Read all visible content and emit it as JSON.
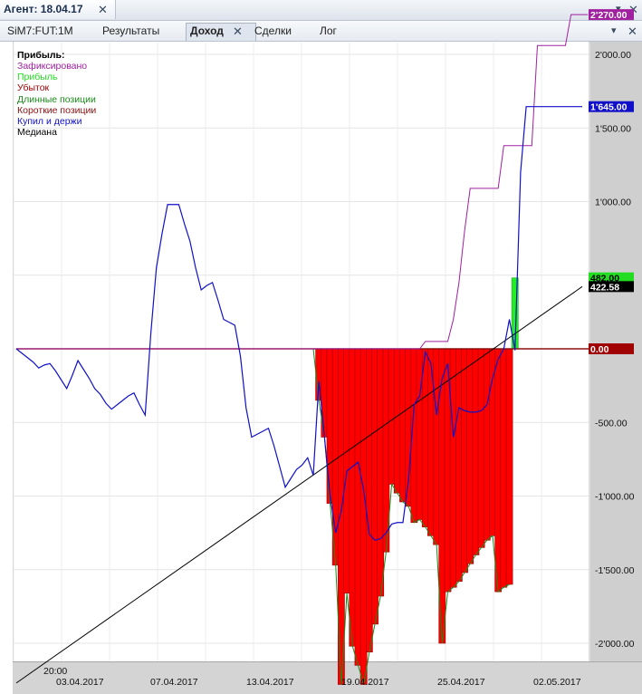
{
  "window": {
    "title": "Агент: 18.04.17",
    "controls": {
      "dropdown": "▾",
      "close": "✕"
    }
  },
  "tabs": [
    {
      "label": "SiM7:FUT:1M",
      "active": false
    },
    {
      "label": "Результаты",
      "active": false
    },
    {
      "label": "Доход",
      "active": true
    },
    {
      "label": "Сделки",
      "active": false
    },
    {
      "label": "Лог",
      "active": false
    }
  ],
  "tabbar_controls": {
    "dropdown": "▾",
    "close": "✕"
  },
  "legend": {
    "title": "Прибыль:",
    "items": [
      {
        "label": "Зафиксировано",
        "color": "#a020a0"
      },
      {
        "label": "Прибыль",
        "color": "#22dd22"
      },
      {
        "label": "Убыток",
        "color": "#a00000"
      },
      {
        "label": "Длинные позиции",
        "color": "#1a8a1a"
      },
      {
        "label": "Короткие позиции",
        "color": "#8b1010"
      },
      {
        "label": "Купил и держи",
        "color": "#1010c8"
      },
      {
        "label": "Медиана",
        "color": "#000000"
      }
    ]
  },
  "chart_data": {
    "type": "line",
    "ylim": [
      -2270,
      2270
    ],
    "y_ticks": [
      2000,
      1500,
      1000,
      500,
      0,
      -500,
      -1000,
      -1500,
      -2000
    ],
    "y_tick_labels": [
      "2'000.00",
      "1'500.00",
      "1'000.00",
      "500.00",
      "0.00",
      "-500.00",
      "-1'000.00",
      "-1'500.00",
      "-2'000.00"
    ],
    "x_top_label": "20:00",
    "x_tick_labels": [
      "03.04.2017",
      "07.04.2017",
      "13.04.2017",
      "19.04.2017",
      "25.04.2017",
      "02.05.2017"
    ],
    "value_labels": [
      {
        "text": "2'270.00",
        "value": 2270,
        "bg": "#a020a0",
        "fg": "#ffffff"
      },
      {
        "text": "1'645.00",
        "value": 1645,
        "bg": "#1010c8",
        "fg": "#ffffff"
      },
      {
        "text": "482.00",
        "value": 482,
        "bg": "#22dd22",
        "fg": "#000000"
      },
      {
        "text": "422.58",
        "value": 422.58,
        "bg": "#000000",
        "fg": "#ffffff"
      },
      {
        "text": "0.00",
        "value": 0,
        "bg": "#a00000",
        "fg": "#ffffff"
      }
    ],
    "series": [
      {
        "name": "Зафиксировано",
        "color": "#a020a0",
        "values": [
          0,
          0,
          0,
          0,
          0,
          0,
          0,
          0,
          0,
          0,
          0,
          0,
          0,
          0,
          0,
          0,
          0,
          0,
          0,
          0,
          0,
          0,
          0,
          0,
          0,
          0,
          0,
          0,
          0,
          0,
          0,
          0,
          0,
          0,
          0,
          0,
          0,
          0,
          0,
          0,
          0,
          0,
          0,
          0,
          0,
          0,
          0,
          0,
          0,
          0,
          0,
          0,
          0,
          0,
          0,
          0,
          0,
          0,
          0,
          0,
          0,
          0,
          0,
          0,
          0,
          0,
          0,
          0,
          0,
          0,
          0,
          0,
          0,
          50,
          50,
          50,
          50,
          50,
          200,
          450,
          800,
          1090,
          1090,
          1090,
          1090,
          1090,
          1090,
          1380,
          1380,
          1380,
          1380,
          1380,
          1380,
          2060,
          2060,
          2060,
          2060,
          2060,
          2060,
          2270,
          2270,
          2270,
          2270
        ]
      },
      {
        "name": "Купил и держи",
        "color": "#1010c8",
        "values": [
          0,
          -30,
          -60,
          -90,
          -130,
          -110,
          -100,
          -150,
          -210,
          -270,
          -180,
          -80,
          -140,
          -200,
          -270,
          -310,
          -370,
          -410,
          -380,
          -350,
          -320,
          -300,
          -380,
          -450,
          100,
          550,
          780,
          980,
          980,
          980,
          850,
          730,
          550,
          400,
          430,
          450,
          330,
          200,
          180,
          160,
          -50,
          -400,
          -600,
          -580,
          -560,
          -540,
          -660,
          -800,
          -940,
          -880,
          -820,
          -790,
          -740,
          -860,
          -220,
          -600,
          -1000,
          -1250,
          -1100,
          -830,
          -800,
          -770,
          -960,
          -1260,
          -1300,
          -1290,
          -1250,
          -1190,
          -1180,
          -1180,
          -890,
          -380,
          -320,
          -20,
          -100,
          -450,
          -200,
          -100,
          -600,
          -400,
          -420,
          -430,
          -430,
          -420,
          -380,
          -200,
          -70,
          0,
          200,
          -10,
          1200,
          1645,
          1645,
          1645,
          1645,
          1645,
          1645,
          1645,
          1645,
          1645,
          1645,
          1645
        ]
      },
      {
        "name": "Медиана",
        "color": "#000000",
        "start": -2270,
        "end": 422.58
      },
      {
        "name": "Убыток",
        "color": "#ff0000",
        "bars": [
          0,
          0,
          0,
          0,
          0,
          0,
          0,
          0,
          0,
          0,
          0,
          0,
          0,
          0,
          0,
          0,
          0,
          0,
          0,
          0,
          0,
          0,
          0,
          0,
          0,
          0,
          0,
          0,
          0,
          0,
          0,
          0,
          0,
          0,
          0,
          0,
          0,
          0,
          0,
          0,
          0,
          0,
          0,
          0,
          0,
          0,
          0,
          0,
          0,
          0,
          0,
          0,
          0,
          0,
          -350,
          -600,
          -1050,
          -1470,
          -2280,
          -1660,
          -2020,
          -2150,
          -2280,
          -2060,
          -1870,
          -1680,
          -1380,
          -920,
          -980,
          -1040,
          -1070,
          -1180,
          -1160,
          -1210,
          -1270,
          -1330,
          -2000,
          -1650,
          -1620,
          -1580,
          -1520,
          -1460,
          -1400,
          -1350,
          -1300,
          -1270,
          -1650,
          -1620,
          -1600,
          482
        ]
      }
    ]
  }
}
